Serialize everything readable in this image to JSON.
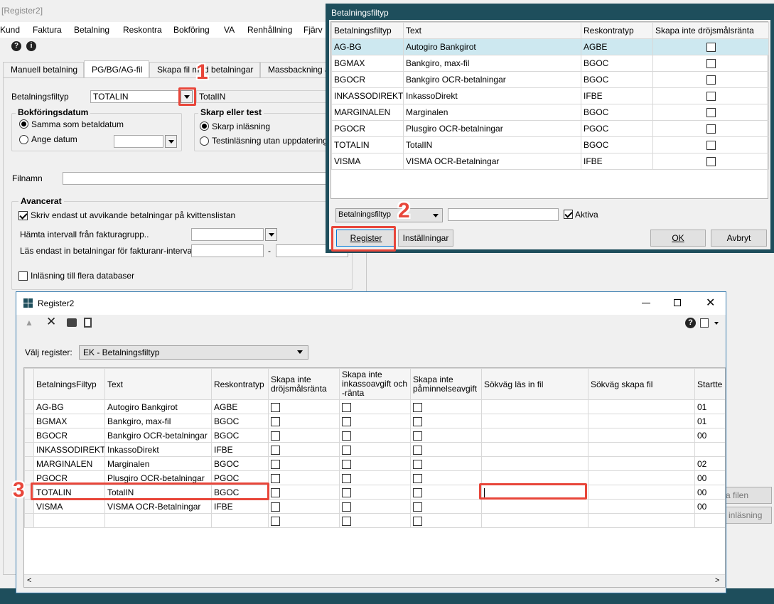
{
  "bg": {
    "title": "[Register2]",
    "menu": [
      "Kund",
      "Faktura",
      "Betalning",
      "Reskontra",
      "Bokföring",
      "VA",
      "Renhållning",
      "Fjärv"
    ],
    "tabs": [
      "Manuell betalning",
      "PG/BG/AG-fil",
      "Skapa fil med betalningar",
      "Massbackning av"
    ],
    "filetype_label": "Betalningsfiltyp",
    "filetype_value": "TOTALIN",
    "filetype_desc": "TotalIN",
    "bokdatum": {
      "title": "Bokföringsdatum",
      "opt1": "Samma som betaldatum",
      "opt2": "Ange datum"
    },
    "skarp": {
      "title": "Skarp eller test",
      "opt1": "Skarp inläsning",
      "opt2": "Testinläsning utan uppdatering"
    },
    "filnamn_label": "Filnamn",
    "avancerat": {
      "title": "Avancerat",
      "check1": "Skriv endast ut avvikande betalningar på kvittenslistan",
      "hamta": "Hämta intervall från fakturagrupp..",
      "las": "Läs endast in betalningar för fakturanr-intervall",
      "dash": "-",
      "check2": "Inläsning till flera databaser"
    },
    "right_btn1": "a filen",
    "right_btn2": "inläsning"
  },
  "dialog": {
    "title": "Betalningsfiltyp",
    "columns": [
      "Betalningsfiltyp",
      "Text",
      "Reskontratyp",
      "Skapa inte dröjsmålsränta"
    ],
    "rows": [
      {
        "code": "AG-BG",
        "text": "Autogiro Bankgirot",
        "type": "AGBE"
      },
      {
        "code": "BGMAX",
        "text": "Bankgiro, max-fil",
        "type": "BGOC"
      },
      {
        "code": "BGOCR",
        "text": "Bankgiro OCR-betalningar",
        "type": "BGOC"
      },
      {
        "code": "INKASSODIREKT",
        "text": "InkassoDirekt",
        "type": "IFBE"
      },
      {
        "code": "MARGINALEN",
        "text": "Marginalen",
        "type": "BGOC"
      },
      {
        "code": "PGOCR",
        "text": "Plusgiro OCR-betalningar",
        "type": "PGOC"
      },
      {
        "code": "TOTALIN",
        "text": "TotalIN",
        "type": "BGOC"
      },
      {
        "code": "VISMA",
        "text": "VISMA OCR-Betalningar",
        "type": "IFBE"
      }
    ],
    "filter_select": "Betalningsfiltyp",
    "aktiva": "Aktiva",
    "btn_register": "Register",
    "btn_installningar": "Inställningar",
    "btn_ok": "OK",
    "btn_avbryt": "Avbryt"
  },
  "reg": {
    "title": "Register2",
    "valj_label": "Välj register:",
    "valj_value": "EK - Betalningsfiltyp",
    "columns": [
      "BetalningsFiltyp",
      "Text",
      "Reskontratyp",
      "Skapa inte dröjsmålsränta",
      "Skapa inte inkassoavgift och -ränta",
      "Skapa inte påminnelseavgift",
      "Sökväg läs in fil",
      "Sökväg skapa fil",
      "Startte"
    ],
    "rows": [
      {
        "code": "AG-BG",
        "text": "Autogiro Bankgirot",
        "type": "AGBE",
        "start": "01"
      },
      {
        "code": "BGMAX",
        "text": "Bankgiro, max-fil",
        "type": "BGOC",
        "start": "01"
      },
      {
        "code": "BGOCR",
        "text": "Bankgiro OCR-betalningar",
        "type": "BGOC",
        "start": "00"
      },
      {
        "code": "INKASSODIREKT",
        "text": "InkassoDirekt",
        "type": "IFBE",
        "start": ""
      },
      {
        "code": "MARGINALEN",
        "text": "Marginalen",
        "type": "BGOC",
        "start": "02"
      },
      {
        "code": "PGOCR",
        "text": "Plusgiro OCR-betalningar",
        "type": "PGOC",
        "start": "00"
      },
      {
        "code": "TOTALIN",
        "text": "TotalIN",
        "type": "BGOC",
        "start": "00"
      },
      {
        "code": "VISMA",
        "text": "VISMA OCR-Betalningar",
        "type": "IFBE",
        "start": "00"
      },
      {
        "code": "",
        "text": "",
        "type": "",
        "start": ""
      }
    ]
  },
  "annotations": {
    "a1": "1",
    "a2": "2",
    "a3": "3"
  },
  "colors": {
    "dialog_title": "#1e4e5c",
    "selected_row": "#cde8f0",
    "annotation": "#e8463a"
  }
}
